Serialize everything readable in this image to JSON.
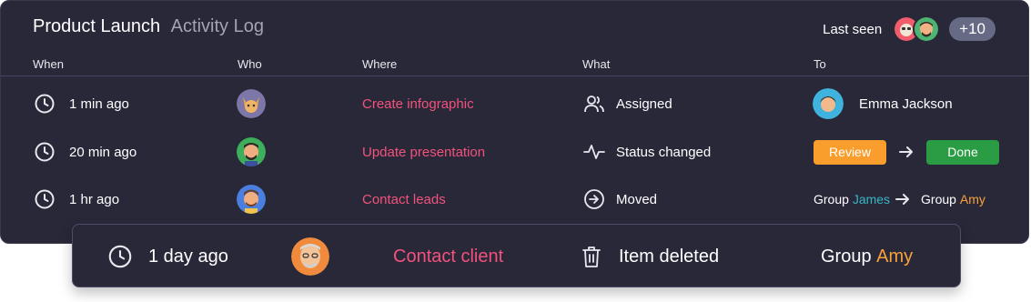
{
  "header": {
    "title": "Product Launch",
    "subtitle": "Activity Log",
    "last_seen_label": "Last seen",
    "extra_count": "+10"
  },
  "columns": {
    "when": "When",
    "who": "Who",
    "where": "Where",
    "what": "What",
    "to": "To"
  },
  "rows": [
    {
      "when": "1 min ago",
      "where": "Create infographic",
      "what": "Assigned",
      "what_icon": "people-icon",
      "to_name": "Emma Jackson"
    },
    {
      "when": "20 min ago",
      "where": "Update presentation",
      "what": "Status changed",
      "what_icon": "pulse-icon",
      "from_status": "Review",
      "to_status": "Done"
    },
    {
      "when": "1 hr ago",
      "where": "Contact leads",
      "what": "Moved",
      "what_icon": "arrow-circle-icon",
      "from_group_label": "Group",
      "from_group_name": "James",
      "to_group_label": "Group",
      "to_group_name": "Amy"
    }
  ],
  "highlight_row": {
    "when": "1 day ago",
    "where": "Contact client",
    "what": "Item deleted",
    "what_icon": "trash-icon",
    "to_group_label": "Group",
    "to_group_name": "Amy"
  },
  "colors": {
    "panel_bg": "#292839",
    "link_pink": "#f2527c",
    "review_orange": "#f99e2d",
    "done_green": "#2a9c44",
    "group_teal": "#36b7c4",
    "group_orange": "#f9a23a"
  }
}
